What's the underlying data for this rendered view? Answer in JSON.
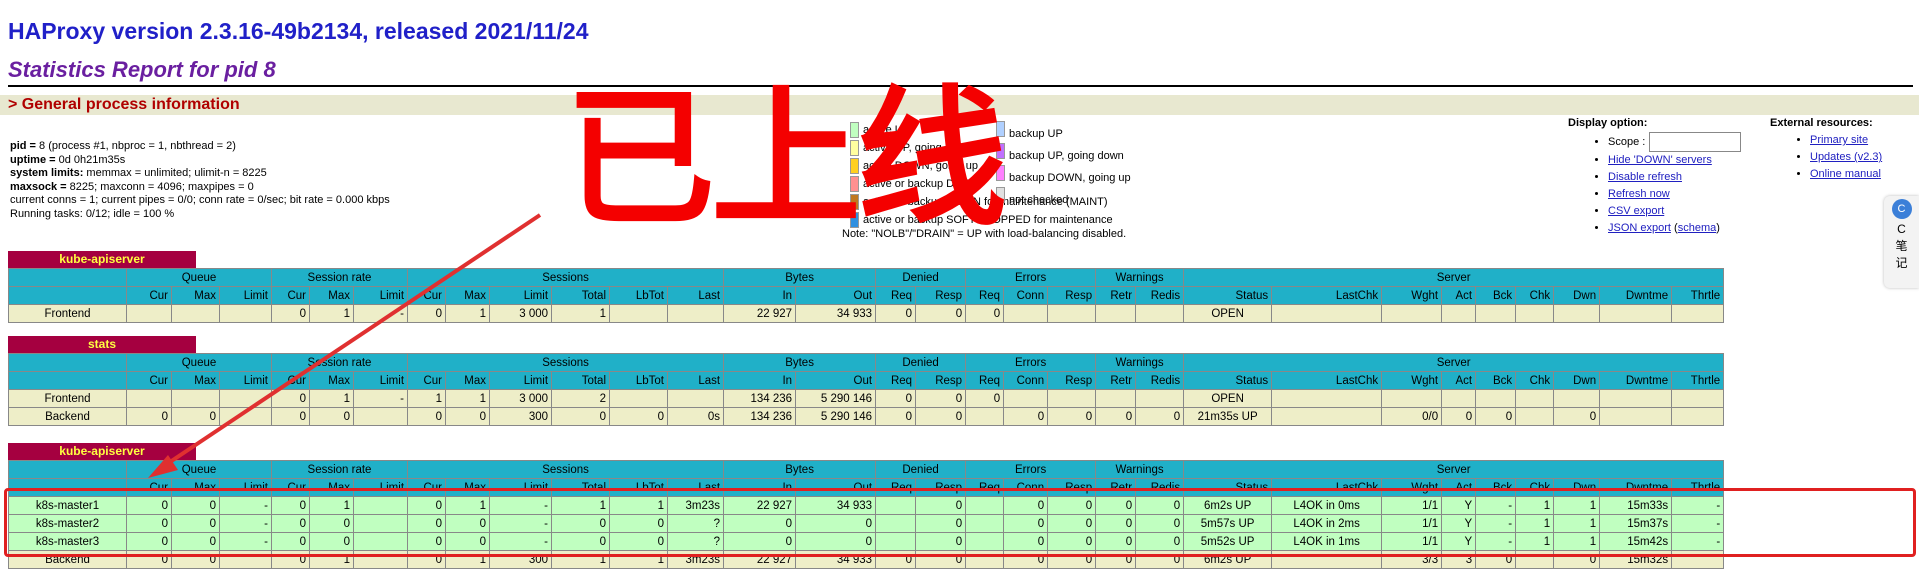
{
  "header": {
    "title": "HAProxy version 2.3.16-49b2134, released 2021/11/24",
    "subtitle": "Statistics Report for pid 8"
  },
  "general": {
    "section_label": "> General process information",
    "lines": [
      {
        "k": "pid =",
        "v": " 8 (process #1, nbproc = 1, nbthread = 2)"
      },
      {
        "k": "uptime =",
        "v": " 0d 0h21m35s"
      },
      {
        "k": "system limits:",
        "v": " memmax = unlimited; ulimit-n = 8225"
      },
      {
        "k": "maxsock =",
        "v": " 8225; maxconn = 4096; maxpipes = 0"
      },
      {
        "k": "",
        "v": "current conns = 1; current pipes = 0/0; conn rate = 0/sec; bit rate = 0.000 kbps"
      },
      {
        "k": "",
        "v": "Running tasks: 0/12; idle = 100 %"
      }
    ]
  },
  "legend": {
    "left": [
      {
        "label": "active UP",
        "color": "#c0ffc0"
      },
      {
        "label": "active UP, going down",
        "color": "#ffffa0"
      },
      {
        "label": "active DOWN, going up",
        "color": "#ffd020"
      },
      {
        "label": "active or backup DOWN",
        "color": "#ff9090"
      },
      {
        "label": "active or backup DOWN for maintenance (MAINT)",
        "color": "#c07820"
      },
      {
        "label": "active or backup SOFT STOPPED for maintenance",
        "color": "#3090e0"
      }
    ],
    "right": [
      {
        "label": "backup UP",
        "color": "#b0d0ff"
      },
      {
        "label": "backup UP, going down",
        "color": "#c070ff"
      },
      {
        "label": "backup DOWN, going up",
        "color": "#ff80ff"
      },
      {
        "label": "not checked",
        "color": "#e0e0e0"
      }
    ],
    "note": "Note: \"NOLB\"/\"DRAIN\" = UP with load-balancing disabled."
  },
  "display_options": {
    "title": "Display option:",
    "scope_label": "Scope :",
    "links": [
      "Hide 'DOWN' servers",
      "Disable refresh",
      "Refresh now",
      "CSV export",
      "JSON export"
    ],
    "schema_link": "schema"
  },
  "external": {
    "title": "External resources:",
    "links": [
      "Primary site",
      "Updates (v2.3)",
      "Online manual"
    ]
  },
  "side_widget": {
    "icon": "C",
    "line1": "C",
    "line2": "笔",
    "line3": "记"
  },
  "overlay": {
    "text": "已上线"
  },
  "headers": {
    "groups": [
      "Queue",
      "Session rate",
      "Sessions",
      "Bytes",
      "Denied",
      "Errors",
      "Warnings",
      "Server"
    ],
    "cols": [
      "Cur",
      "Max",
      "Limit",
      "Cur",
      "Max",
      "Limit",
      "Cur",
      "Max",
      "Limit",
      "Total",
      "LbTot",
      "Last",
      "In",
      "Out",
      "Req",
      "Resp",
      "Req",
      "Conn",
      "Resp",
      "Retr",
      "Redis",
      "Status",
      "LastChk",
      "Wght",
      "Act",
      "Bck",
      "Chk",
      "Dwn",
      "Dwntme",
      "Thrtle"
    ]
  },
  "proxies": [
    {
      "name": "kube-apiserver",
      "rows": [
        {
          "name": "Frontend",
          "cls": "fe",
          "cells": [
            "",
            "",
            "",
            "0",
            "1",
            "-",
            "0",
            "1",
            "3 000",
            "1",
            "",
            "",
            "22 927",
            "34 933",
            "0",
            "0",
            "0",
            "",
            "",
            "",
            "",
            "OPEN",
            "",
            "",
            "",
            "",
            "",
            "",
            "",
            ""
          ]
        }
      ]
    },
    {
      "name": "stats",
      "rows": [
        {
          "name": "Frontend",
          "cls": "fe",
          "cells": [
            "",
            "",
            "",
            "0",
            "1",
            "-",
            "1",
            "1",
            "3 000",
            "2",
            "",
            "",
            "134 236",
            "5 290 146",
            "0",
            "0",
            "0",
            "",
            "",
            "",
            "",
            "OPEN",
            "",
            "",
            "",
            "",
            "",
            "",
            "",
            ""
          ]
        },
        {
          "name": "Backend",
          "cls": "be",
          "cells": [
            "0",
            "0",
            "",
            "0",
            "0",
            "",
            "0",
            "0",
            "300",
            "0",
            "0",
            "0s",
            "134 236",
            "5 290 146",
            "0",
            "0",
            "",
            "0",
            "0",
            "0",
            "0",
            "21m35s UP",
            "",
            "0/0",
            "0",
            "0",
            "",
            "0",
            "",
            ""
          ]
        }
      ]
    },
    {
      "name": "kube-apiserver",
      "rows": [
        {
          "name": "k8s-master1",
          "cls": "up",
          "cells": [
            "0",
            "0",
            "-",
            "0",
            "1",
            "",
            "0",
            "1",
            "-",
            "1",
            "1",
            "3m23s",
            "22 927",
            "34 933",
            "",
            "0",
            "",
            "0",
            "0",
            "0",
            "0",
            "6m2s UP",
            "L4OK in 0ms",
            "1/1",
            "Y",
            "-",
            "1",
            "1",
            "15m33s",
            "-"
          ]
        },
        {
          "name": "k8s-master2",
          "cls": "up",
          "cells": [
            "0",
            "0",
            "-",
            "0",
            "0",
            "",
            "0",
            "0",
            "-",
            "0",
            "0",
            "?",
            "0",
            "0",
            "",
            "0",
            "",
            "0",
            "0",
            "0",
            "0",
            "5m57s UP",
            "L4OK in 2ms",
            "1/1",
            "Y",
            "-",
            "1",
            "1",
            "15m37s",
            "-"
          ]
        },
        {
          "name": "k8s-master3",
          "cls": "up",
          "cells": [
            "0",
            "0",
            "-",
            "0",
            "0",
            "",
            "0",
            "0",
            "-",
            "0",
            "0",
            "?",
            "0",
            "0",
            "",
            "0",
            "",
            "0",
            "0",
            "0",
            "0",
            "5m52s UP",
            "L4OK in 1ms",
            "1/1",
            "Y",
            "-",
            "1",
            "1",
            "15m42s",
            "-"
          ]
        },
        {
          "name": "Backend",
          "cls": "be",
          "cells": [
            "0",
            "0",
            "",
            "0",
            "1",
            "",
            "0",
            "1",
            "300",
            "1",
            "1",
            "3m23s",
            "22 927",
            "34 933",
            "0",
            "0",
            "",
            "0",
            "0",
            "0",
            "0",
            "6m2s UP",
            "",
            "3/3",
            "3",
            "0",
            "",
            "0",
            "15m32s",
            ""
          ]
        }
      ]
    }
  ]
}
